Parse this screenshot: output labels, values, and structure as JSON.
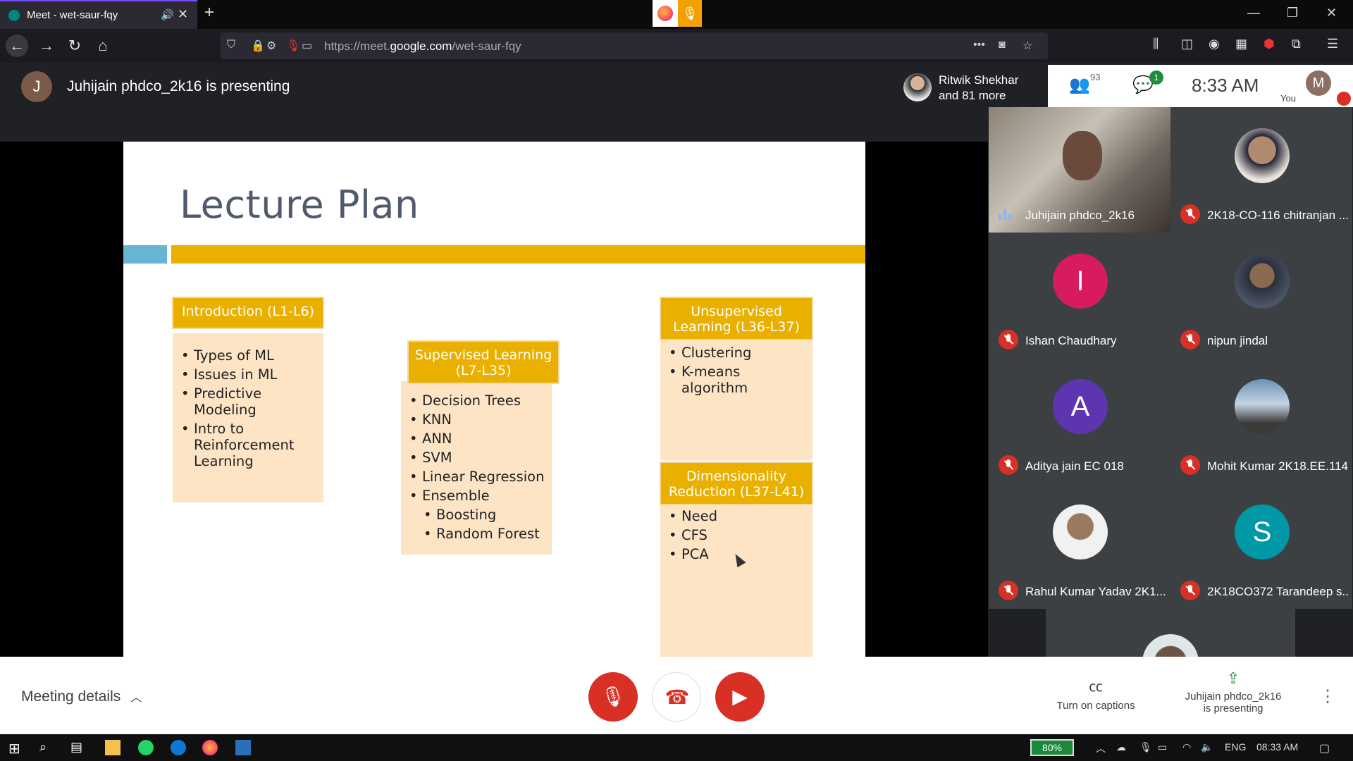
{
  "browser": {
    "tab_title": "Meet - wet-saur-fqy",
    "url_prefix": "https://meet.",
    "url_domain": "google.com",
    "url_path": "/wet-saur-fqy"
  },
  "presenting": {
    "avatar_letter": "J",
    "text": "Juhijain phdco_2k16 is presenting"
  },
  "participant_chip": {
    "line1": "Ritwik Shekhar",
    "line2": "and 81 more"
  },
  "info_bar": {
    "people_count": "93",
    "chat_badge": "1",
    "time": "8:33 AM",
    "you_label": "You",
    "you_avatar": "M"
  },
  "slide": {
    "title": "Lecture Plan",
    "boxes": [
      {
        "head": "Introduction (L1-L6)",
        "items": [
          "Types of ML",
          "Issues in ML",
          "Predictive Modeling",
          "Intro to Reinforcement Learning"
        ]
      },
      {
        "head": "Supervised Learning (L7-L35)",
        "items": [
          "Decision Trees",
          "KNN",
          "ANN",
          "SVM",
          "Linear Regression",
          "Ensemble"
        ],
        "subitems": [
          "Boosting",
          "Random Forest"
        ]
      },
      {
        "head": "Unsupervised Learning (L36-L37)",
        "items": [
          "Clustering",
          "K-means algorithm"
        ]
      },
      {
        "head": "Dimensionality Reduction (L37-L41)",
        "items": [
          "Need",
          "CFS",
          "PCA"
        ]
      }
    ]
  },
  "participants": [
    {
      "name": "Juhijain phdco_2k16",
      "type": "video"
    },
    {
      "name": "2K18-CO-116 chitranjan ...",
      "type": "photo"
    },
    {
      "name": "Ishan Chaudhary",
      "letter": "I",
      "color": "#d81b60"
    },
    {
      "name": "nipun jindal",
      "type": "photo"
    },
    {
      "name": "Aditya jain EC 018",
      "letter": "A",
      "color": "#5e35b1"
    },
    {
      "name": "Mohit Kumar 2K18.EE.114",
      "type": "photo"
    },
    {
      "name": "Rahul Kumar Yadav 2K1...",
      "type": "photo"
    },
    {
      "name": "2K18CO372 Tarandeep s...",
      "letter": "S",
      "color": "#0097a7"
    }
  ],
  "controls": {
    "meeting_details": "Meeting details",
    "captions": "Turn on captions",
    "presenting_line1": "Juhijain phdco_2k16",
    "presenting_line2": "is presenting"
  },
  "taskbar": {
    "battery": "80%",
    "lang": "ENG",
    "time": "08:33 AM"
  }
}
